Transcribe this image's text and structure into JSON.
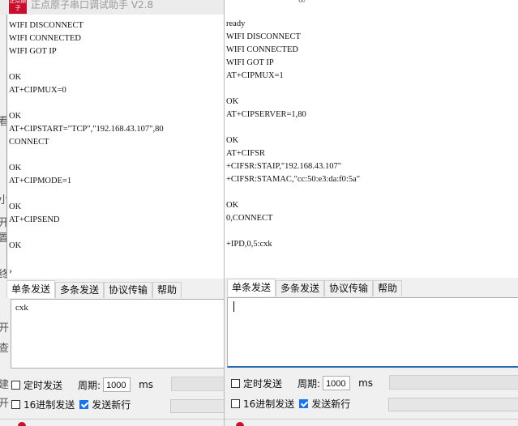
{
  "left_window": {
    "logo_text": "正点原子",
    "title": "正点原子串口调试助手 V2.8",
    "terminal_lines": [
      "WIFI DISCONNECT",
      "WIFI CONNECTED",
      "WIFI GOT IP",
      "",
      "OK",
      "AT+CIPMUX=0",
      "",
      "OK",
      "AT+CIPSTART=\"TCP\",\"192.168.43.107\",80",
      "CONNECT",
      "",
      "OK",
      "AT+CIPMODE=1",
      "",
      "OK",
      "AT+CIPSEND",
      "",
      "OK"
    ],
    "tabs": [
      "单条发送",
      "多条发送",
      "协议传输",
      "帮助"
    ],
    "send_text": "cxk",
    "timed_send_label": "定时发送",
    "period_label": "周期:",
    "period_value": "1000",
    "period_unit": "ms",
    "hex_send_label": "16进制发送",
    "newline_label": "发送新行",
    "side_chars": [
      "看",
      "小",
      "开",
      "置",
      "终",
      "开",
      "查",
      "建",
      "开"
    ]
  },
  "right_window": {
    "terminal_lines": [
      "AI-Thinker Technology Co. Ltd.",
      "",
      "ready",
      "WIFI DISCONNECT",
      "WIFI CONNECTED",
      "WIFI GOT IP",
      "AT+CIPMUX=1",
      "",
      "OK",
      "AT+CIPSERVER=1,80",
      "",
      "OK",
      "AT+CIFSR",
      "+CIFSR:STAIP,\"192.168.43.107\"",
      "+CIFSR:STAMAC,\"cc:50:e3:da:f0:5a\"",
      "",
      "OK",
      "0,CONNECT",
      "",
      "+IPD,0,5:cxk"
    ],
    "tabs": [
      "单条发送",
      "多条发送",
      "协议传输",
      "帮助"
    ],
    "send_text": "",
    "timed_send_label": "定时发送",
    "period_label": "周期:",
    "period_value": "1000",
    "period_unit": "ms",
    "hex_send_label": "16进制发送",
    "newline_label": "发送新行"
  }
}
